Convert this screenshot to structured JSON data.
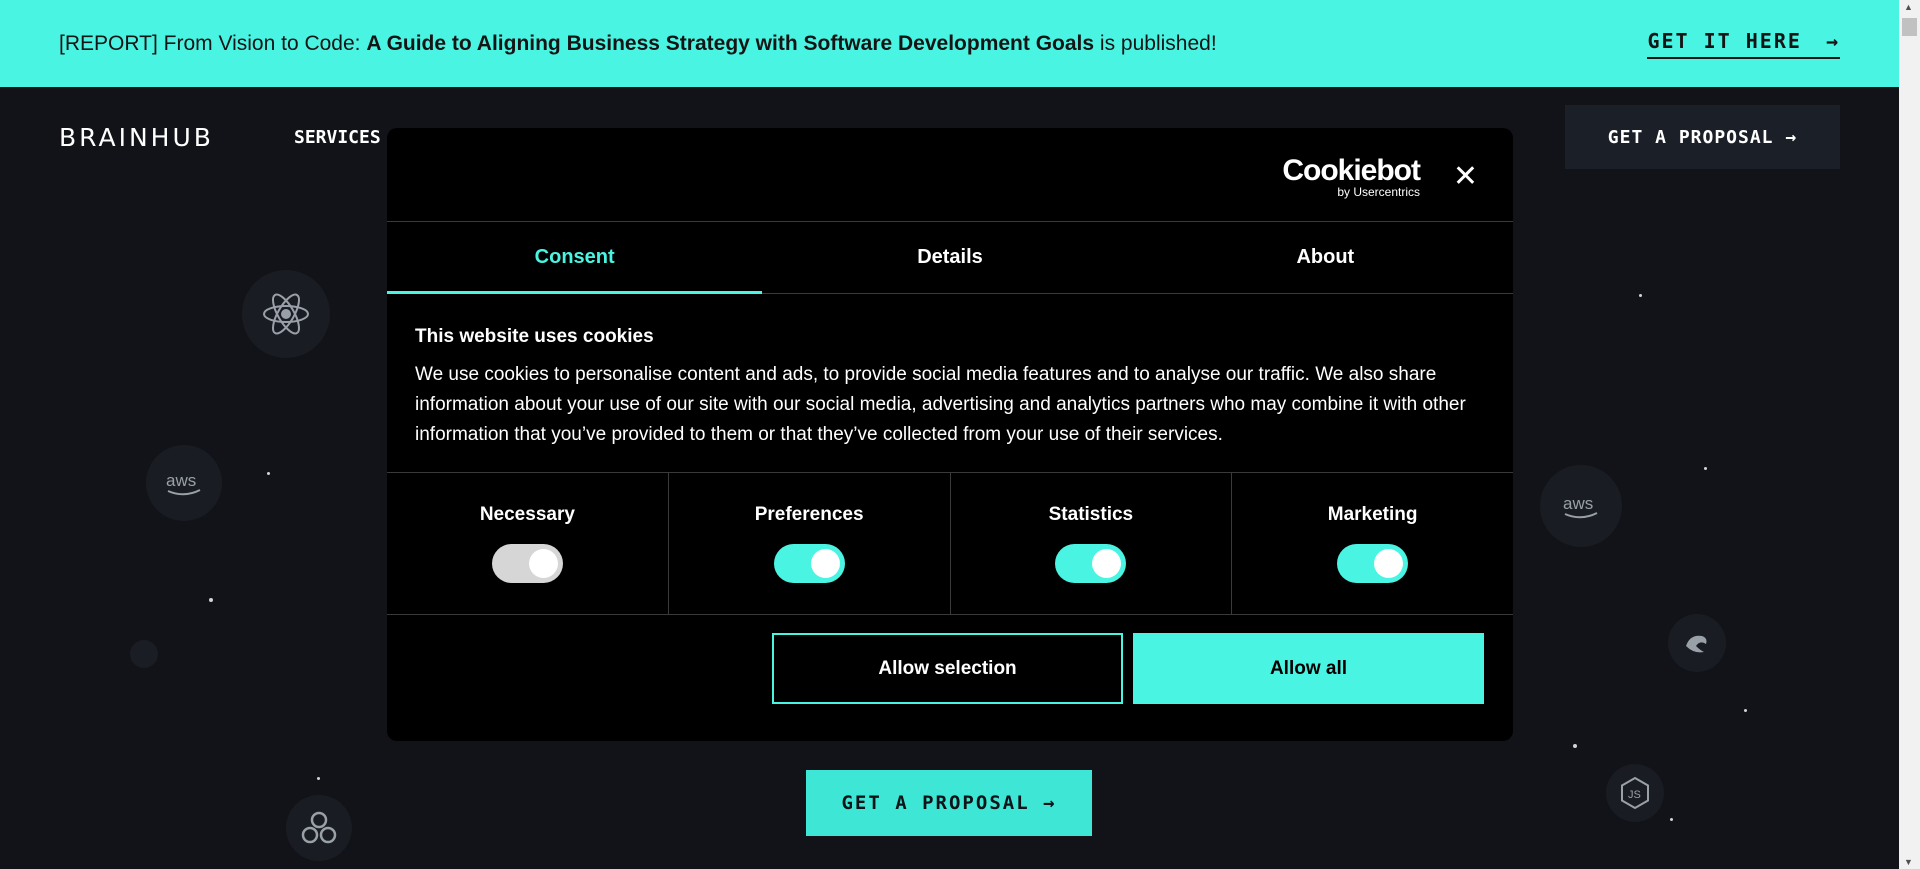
{
  "banner": {
    "prefix": "[REPORT]",
    "text1": " From Vision to Code: ",
    "title": "A Guide to Aligning Business Strategy with Software Development Goals",
    "text2": " is published!",
    "cta": "GET IT HERE",
    "cta_arrow": "→"
  },
  "nav": {
    "logo": "BRAINHUB",
    "services": "SERVICES",
    "proposal": "GET A PROPOSAL →"
  },
  "hero": {
    "proposal": "GET A PROPOSAL →"
  },
  "floating_icons": [
    "react-icon",
    "aws-icon",
    "aws-icon",
    "nestjs-icon",
    "nodejs-icon",
    "redux-icon"
  ],
  "cookie_dialog": {
    "brand": "Cookiebot",
    "brand_sub": "by Usercentrics",
    "close": "✕",
    "tabs": [
      {
        "label": "Consent",
        "active": true
      },
      {
        "label": "Details",
        "active": false
      },
      {
        "label": "About",
        "active": false
      }
    ],
    "heading": "This website uses cookies",
    "description": "We use cookies to personalise content and ads, to provide social media features and to analyse our traffic. We also share information about your use of our site with our social media, advertising and analytics partners who may combine it with other information that you’ve provided to them or that they’ve collected from your use of their services.",
    "categories": [
      {
        "label": "Necessary",
        "enabled": true,
        "locked": true
      },
      {
        "label": "Preferences",
        "enabled": true,
        "locked": false
      },
      {
        "label": "Statistics",
        "enabled": true,
        "locked": false
      },
      {
        "label": "Marketing",
        "enabled": true,
        "locked": false
      }
    ],
    "allow_selection": "Allow selection",
    "allow_all": "Allow all"
  },
  "colors": {
    "accent": "#4af4e2",
    "background": "#111318",
    "dialog": "#000000"
  }
}
